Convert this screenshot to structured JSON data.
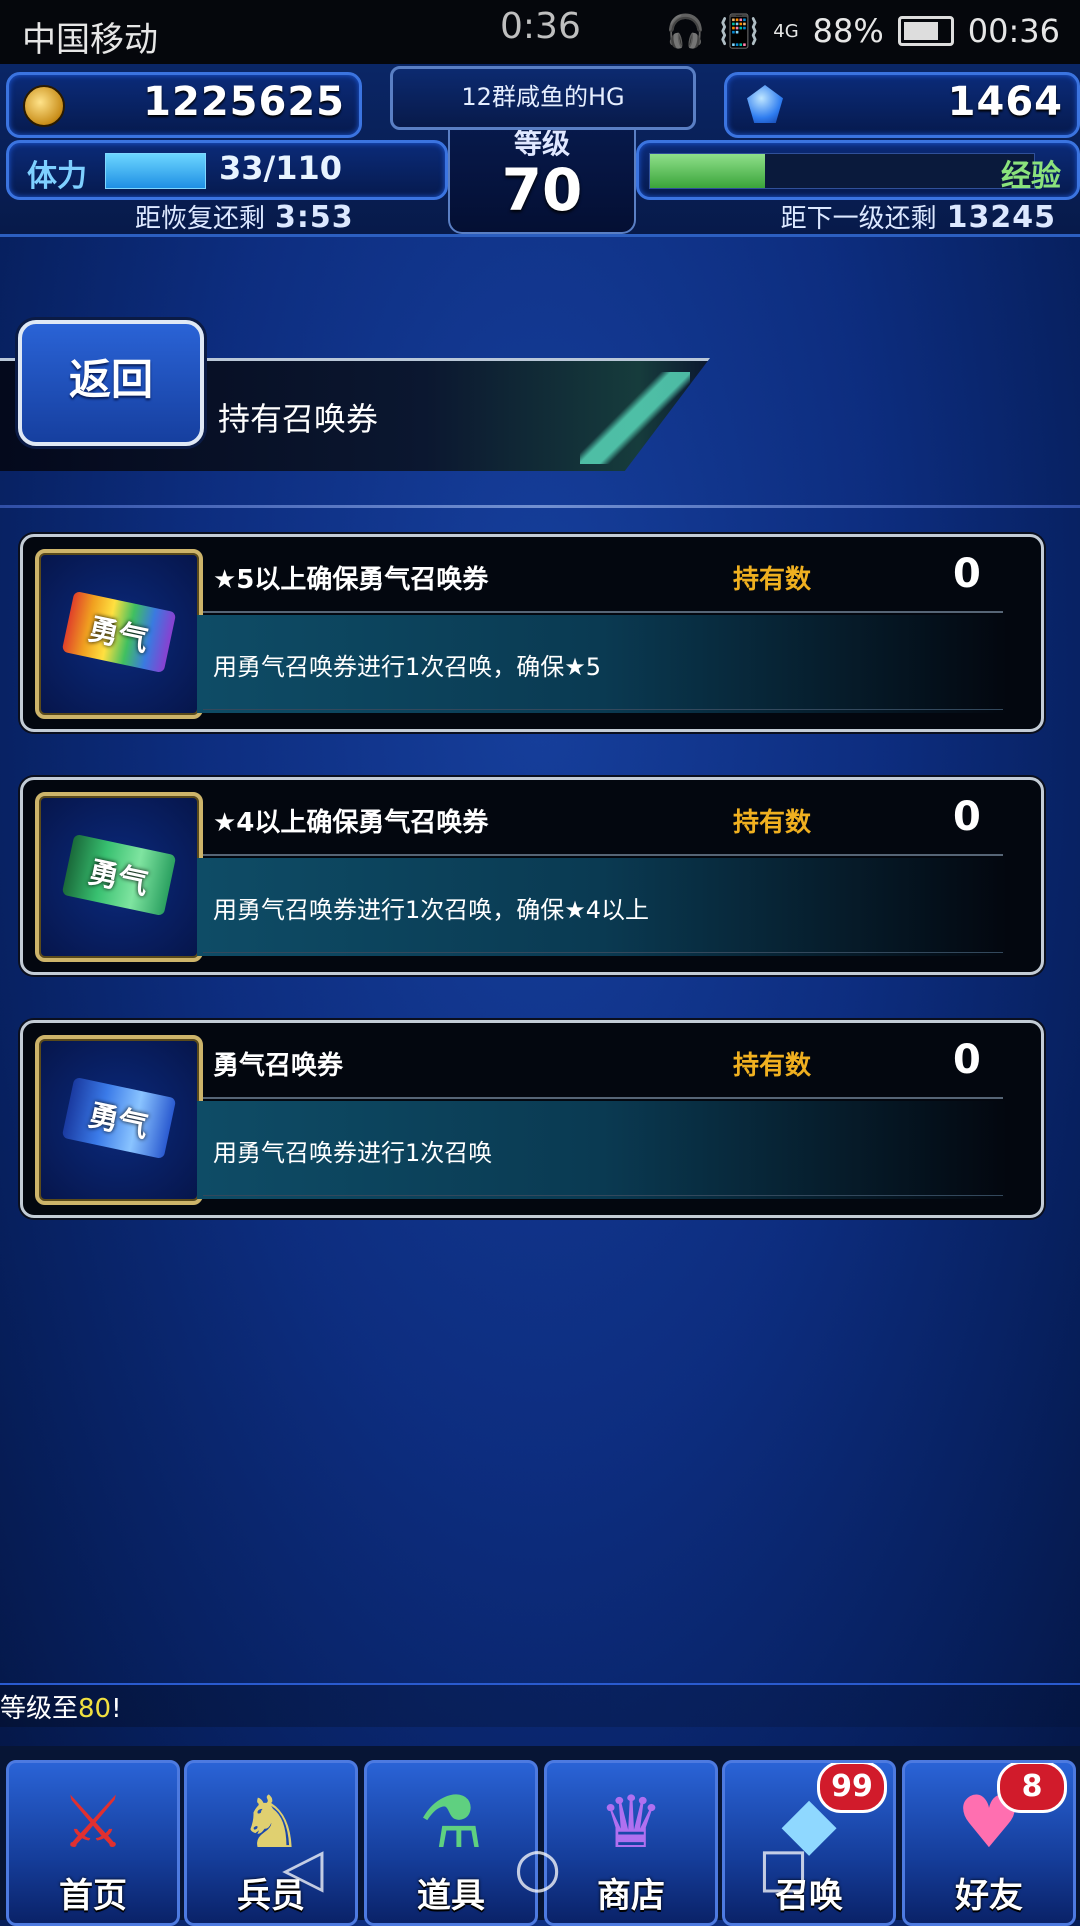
{
  "status_bar": {
    "carrier": "中国移动",
    "clock_center": "0:36",
    "signal": "4G",
    "battery": "88%",
    "clock_right": "00:36"
  },
  "hud": {
    "gil": "1225625",
    "gems": "1464",
    "player_name": "12群咸鱼的HG",
    "level_label": "等级",
    "level": "70",
    "stamina_label": "体力",
    "stamina_value": "33/110",
    "stamina_fraction": 0.3,
    "recover_label": "距恢复还剩",
    "recover_time": "3:53",
    "exp_label": "经验",
    "exp_fraction": 0.3,
    "next_level_label": "距下一级还剩",
    "next_level_exp": "13245"
  },
  "header": {
    "back_label": "返回",
    "title": "持有召唤券"
  },
  "tickets": [
    {
      "name": "★5以上确保勇气召唤券",
      "count_label": "持有数",
      "count": "0",
      "desc": "用勇气召唤券进行1次召唤，确保★5",
      "art_text": "勇气",
      "icon": "rainbow-ticket-icon"
    },
    {
      "name": "★4以上确保勇气召唤券",
      "count_label": "持有数",
      "count": "0",
      "desc": "用勇气召唤券进行1次召唤，确保★4以上",
      "art_text": "勇气",
      "icon": "green-ticket-icon"
    },
    {
      "name": "勇气召唤券",
      "count_label": "持有数",
      "count": "0",
      "desc": "用勇气召唤券进行1次召唤",
      "art_text": "勇气",
      "icon": "blue-ticket-icon"
    }
  ],
  "marquee": {
    "text_before": "等级至",
    "highlight": "80",
    "text_after": "!"
  },
  "bottom_nav": [
    {
      "label": "首页",
      "icon": "crossed-swords-icon",
      "badge": ""
    },
    {
      "label": "兵员",
      "icon": "unit-icon",
      "badge": ""
    },
    {
      "label": "道具",
      "icon": "potion-icon",
      "badge": ""
    },
    {
      "label": "商店",
      "icon": "shop-chest-icon",
      "badge": ""
    },
    {
      "label": "召唤",
      "icon": "crystal-icon",
      "badge": "99"
    },
    {
      "label": "好友",
      "icon": "friend-icon",
      "badge": "8"
    }
  ],
  "colors": {
    "accent": "#2a63d6",
    "gold": "#f0b020",
    "exp_green": "#3aa43a",
    "badge_red": "#d11b2b"
  }
}
